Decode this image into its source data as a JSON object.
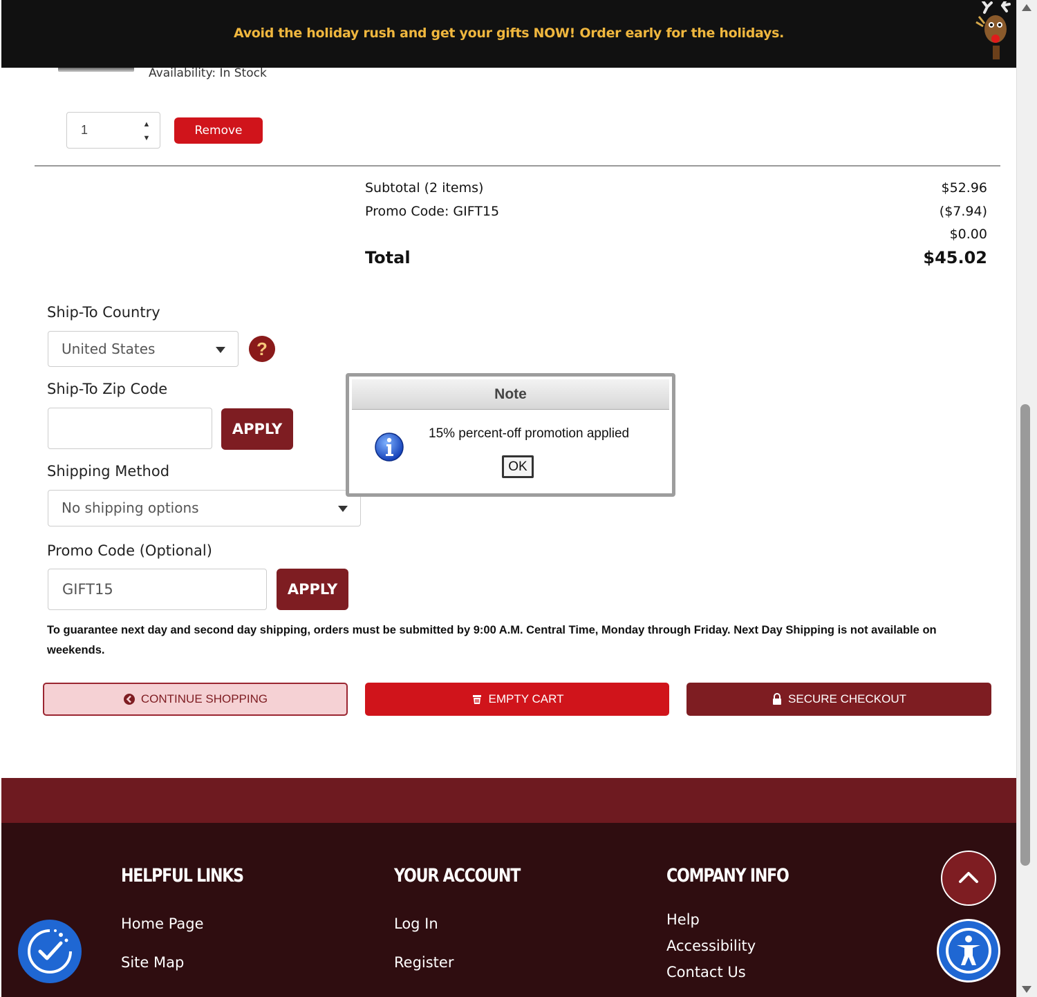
{
  "banner": {
    "text": "Avoid the holiday rush and get your gifts NOW! Order early for the holidays."
  },
  "cart_item": {
    "availability": "Availability: In Stock",
    "quantity": "1",
    "remove_label": "Remove"
  },
  "totals": {
    "subtotal_label": "Subtotal (2 items)",
    "subtotal_value": "$52.96",
    "promo_label": "Promo Code: GIFT15",
    "promo_value": "($7.94)",
    "shipping_value": "$0.00",
    "total_label": "Total",
    "total_value": "$45.02"
  },
  "form": {
    "country_label": "Ship-To Country",
    "country_value": "United States",
    "help_glyph": "?",
    "zip_label": "Ship-To Zip Code",
    "zip_value": "",
    "zip_apply": "APPLY",
    "shipping_label": "Shipping Method",
    "shipping_value": "No shipping options",
    "promo_label": "Promo Code (Optional)",
    "promo_value": "GIFT15",
    "promo_apply": "APPLY",
    "guarantee": "To guarantee next day and second day shipping, orders must be submitted by 9:00 A.M. Central Time, Monday through Friday. Next Day Shipping is not available on weekends."
  },
  "actions": {
    "continue": "CONTINUE SHOPPING",
    "empty": "EMPTY CART",
    "secure": "SECURE CHECKOUT"
  },
  "footer": {
    "helpful_links": {
      "heading": "HELPFUL LINKS",
      "links": [
        "Home Page",
        "Site Map"
      ]
    },
    "your_account": {
      "heading": "YOUR ACCOUNT",
      "links": [
        "Log In",
        "Register"
      ]
    },
    "company_info": {
      "heading": "COMPANY INFO",
      "links": [
        "Help",
        "Accessibility",
        "Contact Us"
      ]
    }
  },
  "dialog": {
    "title": "Note",
    "message": "15% percent-off promotion applied",
    "ok": "OK"
  },
  "colors": {
    "brand_dark": "#7e1d22",
    "brand_red": "#d0141b",
    "banner_text": "#f0b73e",
    "footer_bg": "#2f0d10",
    "accessibility_blue": "#1f67d3"
  }
}
